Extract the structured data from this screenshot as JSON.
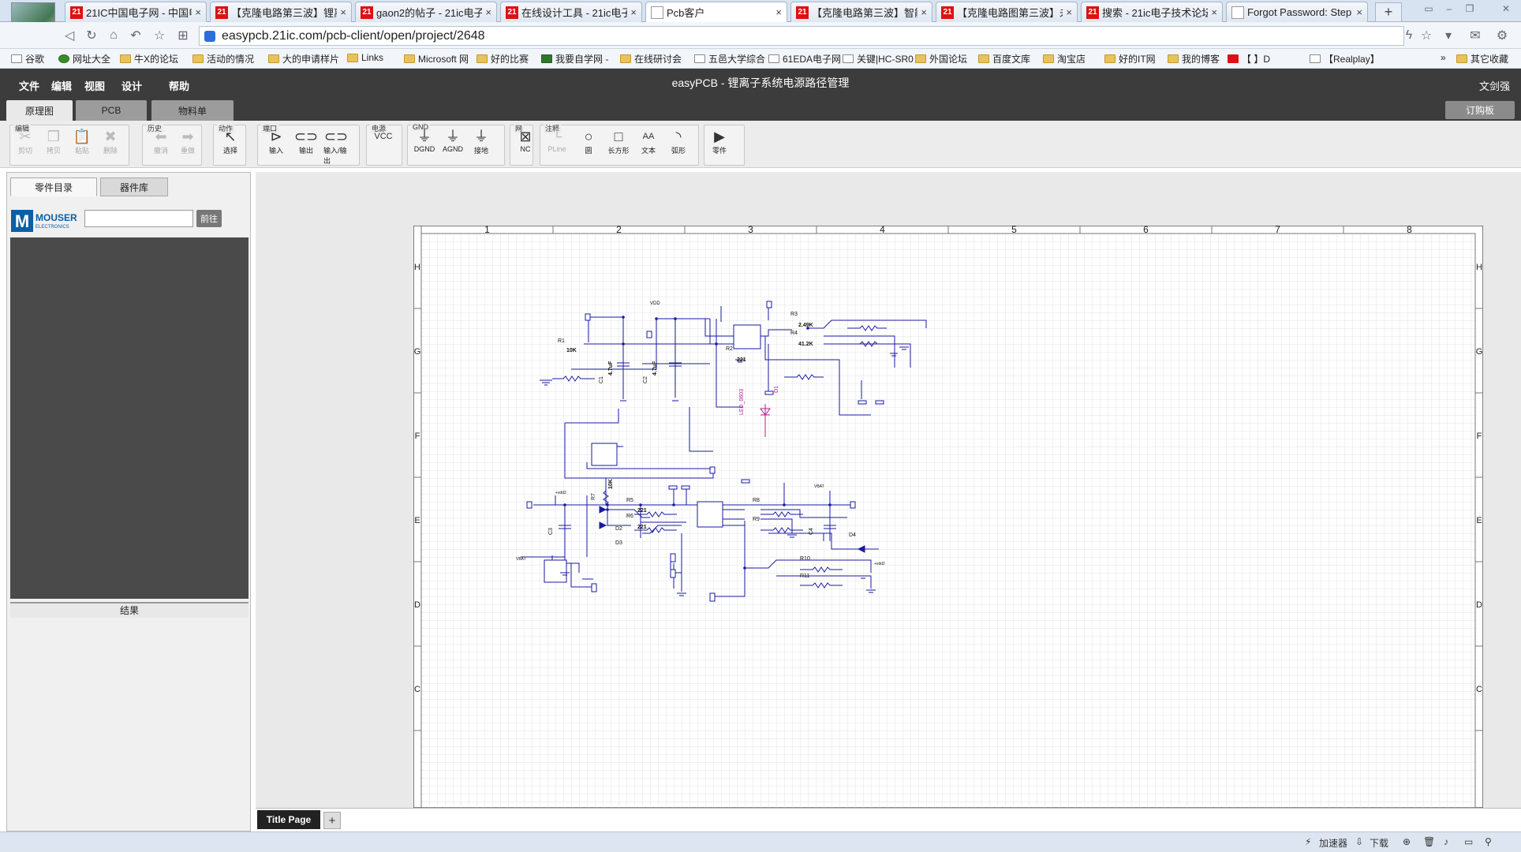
{
  "browser": {
    "tabs": [
      {
        "label": "21IC中国电子网 - 中国电",
        "favicon": "21",
        "active": false
      },
      {
        "label": "【克隆电路第三波】锂离",
        "favicon": "21",
        "active": false
      },
      {
        "label": "gaon2的帖子 - 21ic电子",
        "favicon": "21",
        "active": false
      },
      {
        "label": "在线设计工具 - 21ic电子",
        "favicon": "21",
        "active": false
      },
      {
        "label": "Pcb客户",
        "favicon": "doc",
        "active": true
      },
      {
        "label": "【克隆电路第三波】智能",
        "favicon": "21",
        "active": false
      },
      {
        "label": "【克隆电路图第三波】未",
        "favicon": "21",
        "active": false
      },
      {
        "label": "搜索 - 21ic电子技术论坛",
        "favicon": "21",
        "active": false
      },
      {
        "label": "Forgot Password: Step",
        "favicon": "doc",
        "active": false
      }
    ],
    "tab_close": "×",
    "new_tab": "+",
    "url": "easypcb.21ic.com/pcb-client/open/project/2648",
    "bookmarks": [
      {
        "label": "谷歌",
        "icon": "page"
      },
      {
        "label": "网址大全",
        "icon": "green"
      },
      {
        "label": "牛X的论坛",
        "icon": "folder"
      },
      {
        "label": "活动的情况",
        "icon": "folder"
      },
      {
        "label": "大的申请样片",
        "icon": "folder"
      },
      {
        "label": "Links",
        "icon": "folder"
      },
      {
        "label": "Microsoft 网",
        "icon": "folder"
      },
      {
        "label": "好的比赛",
        "icon": "folder"
      },
      {
        "label": "我要自学网 -",
        "icon": "v"
      },
      {
        "label": "在线研讨会",
        "icon": "folder"
      },
      {
        "label": "五邑大学综合",
        "icon": "page"
      },
      {
        "label": "61EDA电子网",
        "icon": "page"
      },
      {
        "label": "关键|HC-SR0",
        "icon": "page"
      },
      {
        "label": "外国论坛",
        "icon": "folder"
      },
      {
        "label": "百度文库",
        "icon": "folder"
      },
      {
        "label": "淘宝店",
        "icon": "folder"
      },
      {
        "label": "好的IT网",
        "icon": "folder"
      },
      {
        "label": "我的博客",
        "icon": "folder"
      },
      {
        "label": "【                    】D",
        "icon": "red"
      },
      {
        "label": "【Realplay】",
        "icon": "page"
      }
    ],
    "bookmarks_more": "»",
    "other_bookmarks": "其它收藏"
  },
  "app": {
    "menu": [
      "文件",
      "编辑",
      "视图",
      "设计",
      "帮助"
    ],
    "title": "easyPCB - 锂离子系统电源路径管理",
    "user": "文剑强",
    "tabs": [
      "原理图",
      "PCB",
      "物料单"
    ],
    "clipboard_button": "订购板"
  },
  "toolbar": {
    "groups": [
      {
        "label": "编辑",
        "tools": [
          {
            "label": "剪切",
            "icon": "✂",
            "enabled": false
          },
          {
            "label": "拷贝",
            "icon": "❐",
            "enabled": false
          },
          {
            "label": "粘贴",
            "icon": "📋",
            "enabled": false
          },
          {
            "label": "删除",
            "icon": "✖",
            "enabled": false
          }
        ]
      },
      {
        "label": "历史",
        "tools": [
          {
            "label": "撤消",
            "icon": "⬅",
            "enabled": false
          },
          {
            "label": "重做",
            "icon": "➡",
            "enabled": false
          }
        ]
      },
      {
        "label": "动作",
        "tools": [
          {
            "label": "选择",
            "icon": "↖",
            "enabled": true
          }
        ]
      },
      {
        "label": "端口",
        "tools": [
          {
            "label": "输入",
            "icon": "⊳",
            "enabled": true
          },
          {
            "label": "输出",
            "icon": "⊂⊃",
            "enabled": true
          },
          {
            "label": "输入/输出",
            "icon": "⊂⊃",
            "enabled": true
          }
        ]
      },
      {
        "label": "电源",
        "tools": [
          {
            "label": "",
            "icon": "VCC",
            "enabled": true
          }
        ]
      },
      {
        "label": "GND",
        "tools": [
          {
            "label": "DGND",
            "icon": "⏚",
            "enabled": true
          },
          {
            "label": "AGND",
            "icon": "⏚",
            "enabled": true
          },
          {
            "label": "接地",
            "icon": "⏚",
            "enabled": true
          }
        ]
      },
      {
        "label": "网",
        "tools": [
          {
            "label": "NC",
            "icon": "⊠",
            "enabled": true
          }
        ]
      },
      {
        "label": "注释",
        "tools": [
          {
            "label": "PLine",
            "icon": "└",
            "enabled": false
          },
          {
            "label": "圆",
            "icon": "○",
            "enabled": true
          },
          {
            "label": "长方形",
            "icon": "□",
            "enabled": true
          },
          {
            "label": "文本",
            "icon": "AA",
            "enabled": true
          },
          {
            "label": "弧形",
            "icon": "◝",
            "enabled": true
          }
        ]
      },
      {
        "label": "",
        "tools": [
          {
            "label": "零件",
            "icon": "▶",
            "enabled": true
          }
        ]
      }
    ]
  },
  "left_panel": {
    "tabs": [
      "零件目录",
      "器件库"
    ],
    "mouser_label": "MOUSER",
    "mouser_sub": "ELECTRONICS",
    "search_value": "",
    "go_button": "前往",
    "results_label": "结果"
  },
  "schematic": {
    "columns": [
      "1",
      "2",
      "3",
      "4",
      "5",
      "6",
      "7",
      "8"
    ],
    "rows": [
      "H",
      "G",
      "F",
      "E",
      "D",
      "C"
    ],
    "labels": {
      "R1": "R1",
      "R1v": "10K",
      "C1": "C1",
      "C1v": "4.7uF",
      "C2": "C2",
      "C2v": "4.7uF",
      "R2": "R2",
      "R2v": "221",
      "R3": "R3",
      "R3v": "2.49K",
      "R4": "R4",
      "R4v": "41.2K",
      "D1": "D1",
      "LED": "LED_0603",
      "VDD": "VDD",
      "R5": "R5",
      "R5v": "221",
      "R6": "R6",
      "R6v": "221",
      "R7": "R7",
      "R7v": "10K",
      "R8": "R8",
      "R9": "R9",
      "R10": "R10",
      "R11": "R11",
      "D2": "D2",
      "D3": "D3",
      "D4": "D4",
      "C3": "C3",
      "C4": "C4",
      "VBAT1": "VBAT",
      "VBAT2": "VBAT",
      "VDD2a": "+vdd2",
      "VDD2b": "+vdd2"
    }
  },
  "page_tabs": {
    "title_page": "Title Page",
    "add": "+"
  },
  "statusbar": {
    "accelerator": "加速器",
    "download": "下载"
  }
}
